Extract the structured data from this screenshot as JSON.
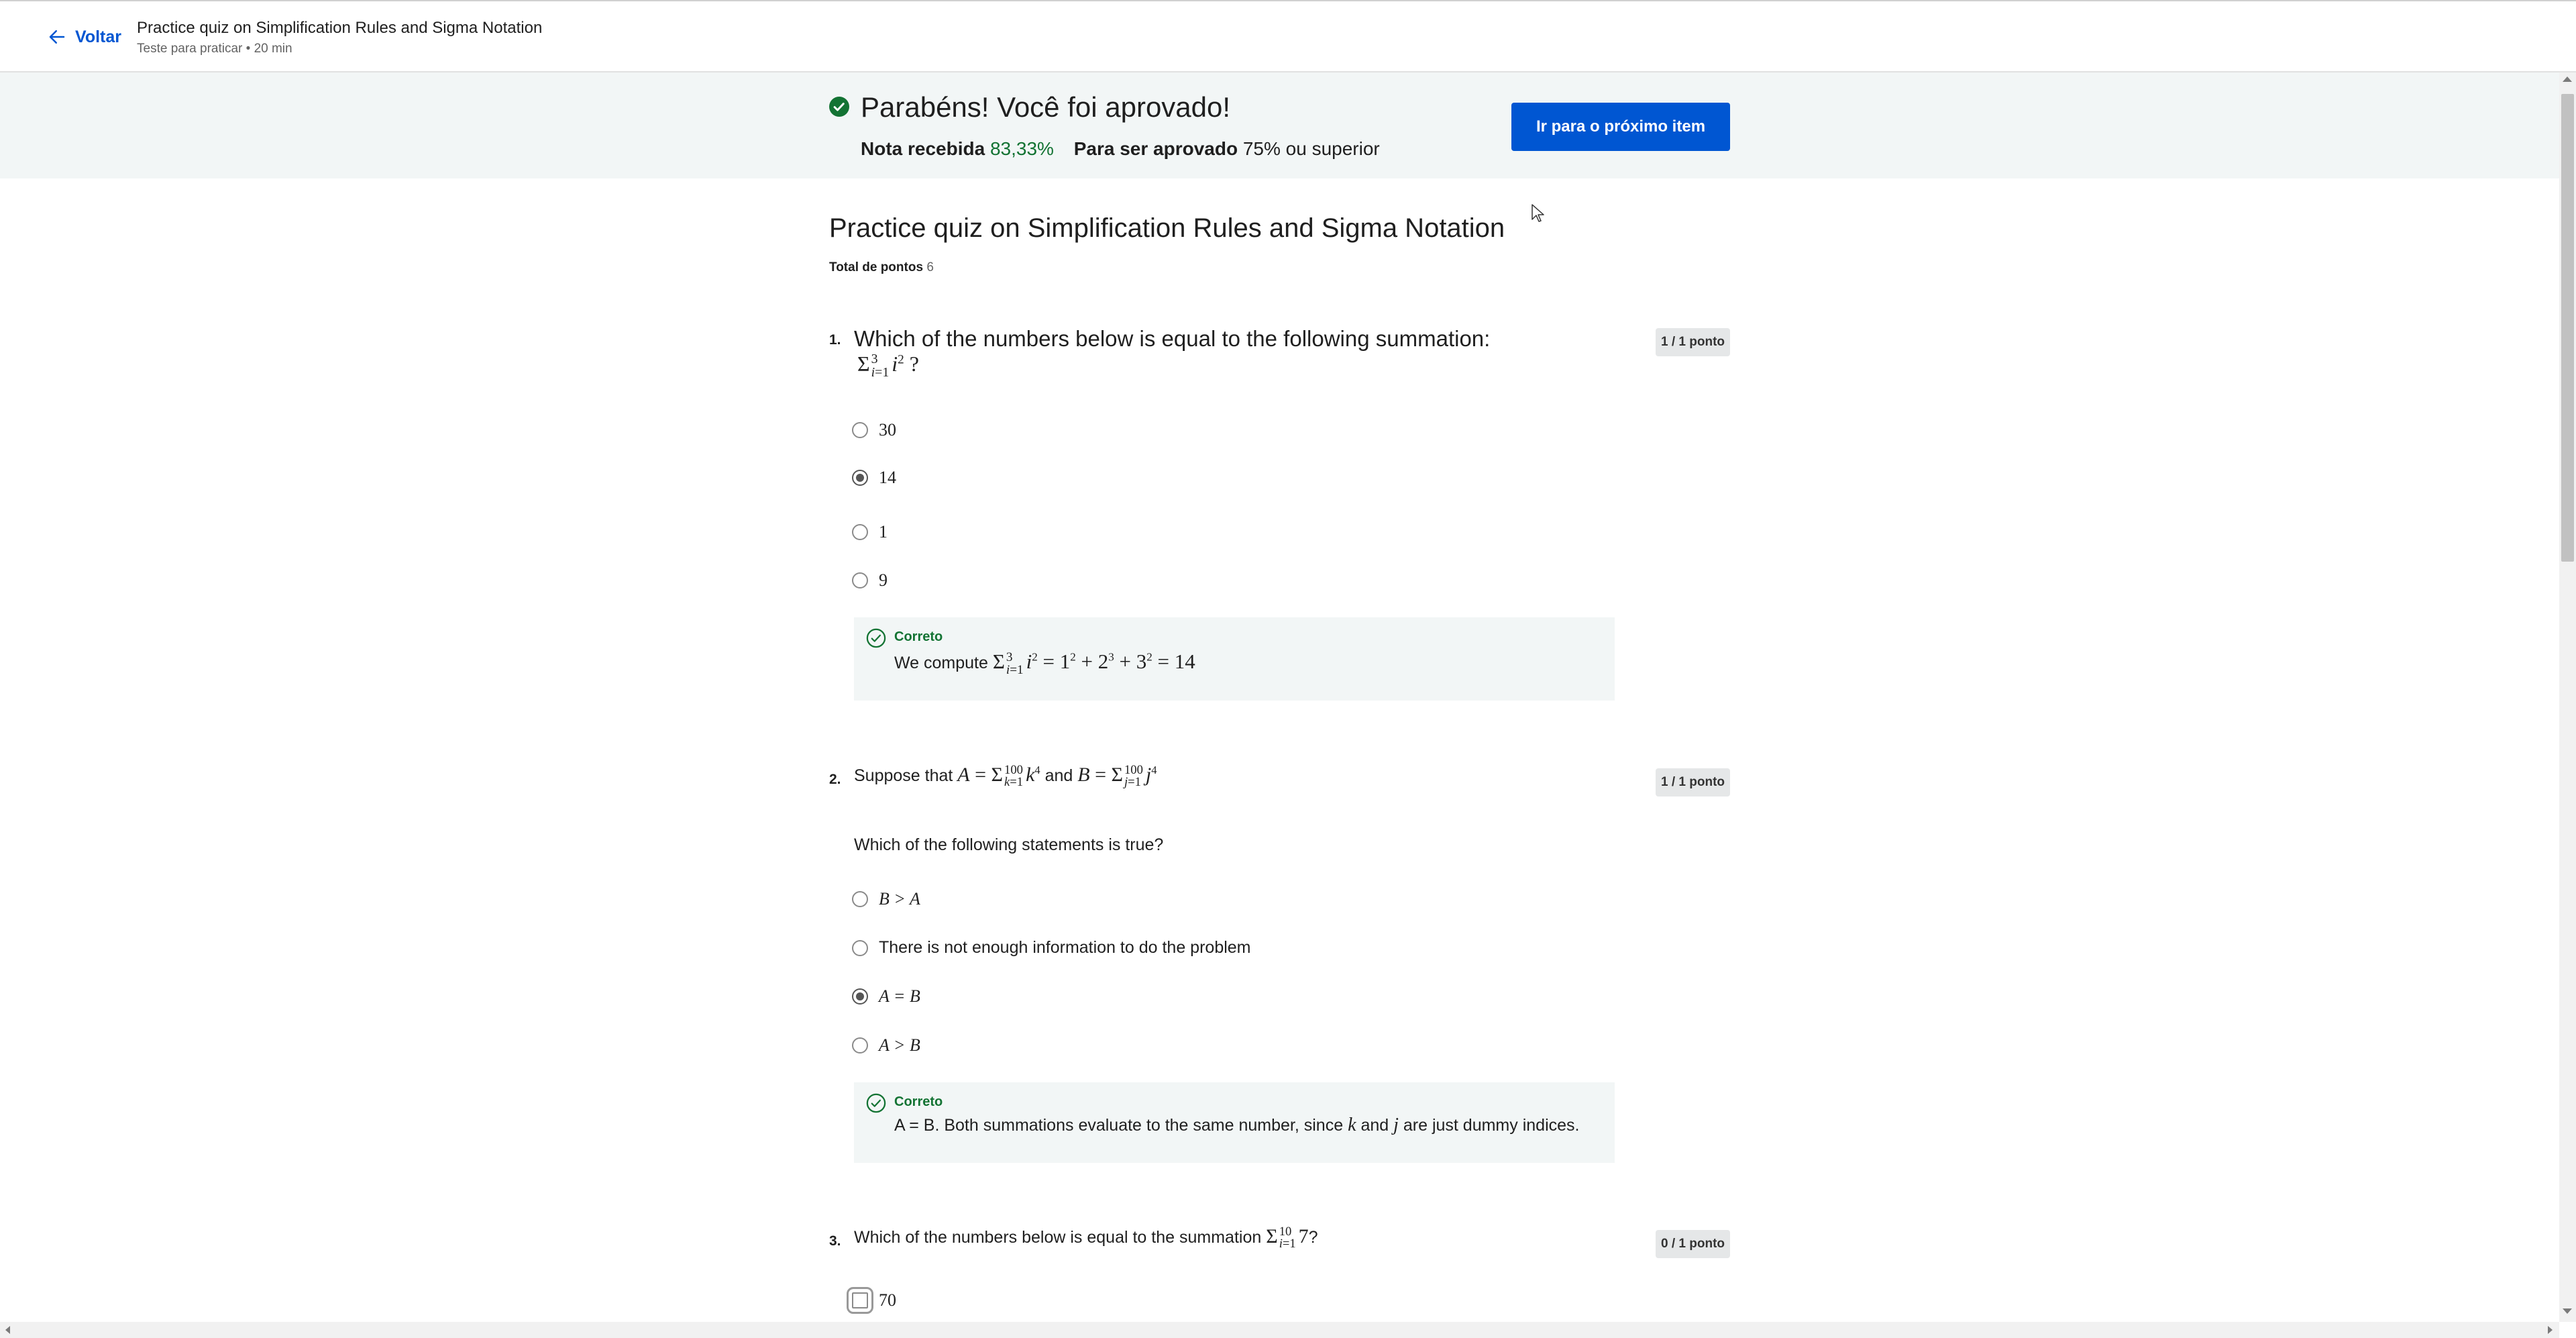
{
  "header": {
    "back_label": "Voltar",
    "title": "Practice quiz on Simplification Rules and Sigma Notation",
    "subtitle": "Teste para praticar • 20 min"
  },
  "banner": {
    "title": "Parabéns! Você foi aprovado!",
    "grade_label": "Nota recebida",
    "grade_value": "83,33%",
    "pass_label": "Para ser aprovado",
    "pass_value": "75% ou superior",
    "next_button": "Ir para o próximo item",
    "colors": {
      "success": "#137333",
      "accent": "#0056d2",
      "banner_bg": "#f2f6f6"
    }
  },
  "quiz": {
    "title": "Practice quiz on Simplification Rules and Sigma Notation",
    "total_label": "Total de pontos",
    "total_value": "6"
  },
  "questions": [
    {
      "number": "1.",
      "text": "Which of the numbers below is equal to the following summation:",
      "formula_suffix": "?",
      "score": "1 / 1 ponto",
      "options": [
        {
          "label": "30",
          "selected": false
        },
        {
          "label": "14",
          "selected": true
        },
        {
          "label": "1",
          "selected": false
        },
        {
          "label": "9",
          "selected": false
        }
      ],
      "feedback": {
        "label": "Correto",
        "text_prefix": "We compute",
        "formula_result": "= 1",
        "formula_tail": "= 14"
      }
    },
    {
      "number": "2.",
      "text_suppose": "Suppose that",
      "text_and": "and",
      "prompt": "Which of the following statements is true?",
      "score": "1 / 1 ponto",
      "options": [
        {
          "label": "B > A",
          "selected": false,
          "math": true
        },
        {
          "label": "There is not enough information to do the problem",
          "selected": false,
          "math": false
        },
        {
          "label": "A = B",
          "selected": true,
          "math": true
        },
        {
          "label": "A > B",
          "selected": false,
          "math": true
        }
      ],
      "feedback": {
        "label": "Correto",
        "text_start": "A = B. Both summations evaluate to the same number, since",
        "text_and": "and",
        "text_end": "are just dummy indices."
      }
    },
    {
      "number": "3.",
      "text": "Which of the numbers below is equal to the summation",
      "formula_suffix": "?",
      "score": "0 / 1 ponto",
      "options": [
        {
          "label": "70",
          "selected": false
        }
      ]
    }
  ],
  "icons": {
    "back": "arrow-left-icon",
    "success": "check-circle-icon",
    "cursor": "mouse-pointer-icon"
  }
}
